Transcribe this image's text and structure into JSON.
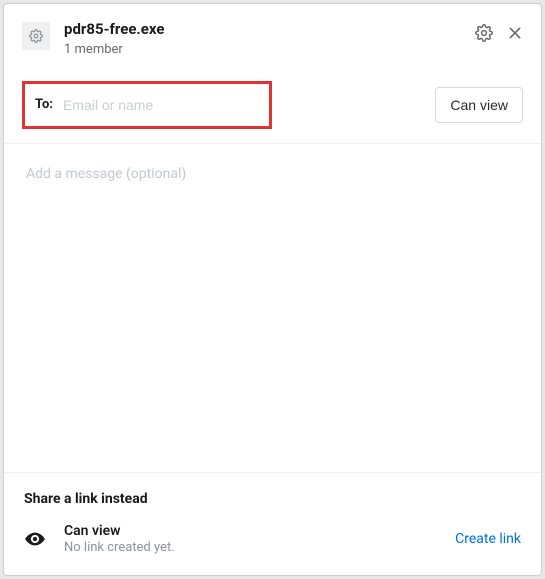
{
  "header": {
    "filename": "pdr85-free.exe",
    "member_count": "1 member"
  },
  "recipient": {
    "to_label": "To:",
    "placeholder": "Email or name",
    "value": "",
    "permission_label": "Can view"
  },
  "message": {
    "placeholder": "Add a message (optional)",
    "value": ""
  },
  "footer": {
    "title": "Share a link instead",
    "link_permission": "Can view",
    "link_status": "No link created yet.",
    "create_link_label": "Create link"
  }
}
